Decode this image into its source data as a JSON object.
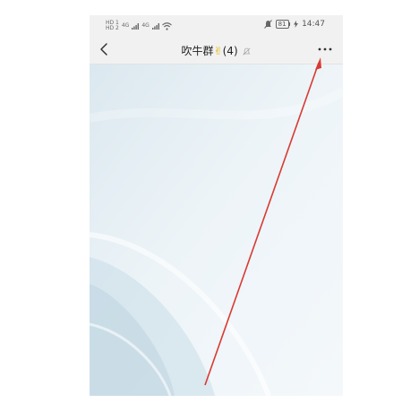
{
  "status_bar": {
    "sim1": "HD 1",
    "sim2": "HD 2",
    "net1": "4G",
    "net2": "4G",
    "battery": "81",
    "time": "14:47"
  },
  "nav": {
    "title": "吹牛群",
    "title_emoji": "✌",
    "member_count": "(4)"
  },
  "icons": {
    "back": "chevron-left-icon",
    "muted": "bell-off-icon",
    "more": "more-dots-icon",
    "wifi": "wifi-icon",
    "signal": "signal-icon",
    "silent": "mute-icon",
    "battery": "battery-icon",
    "charging": "bolt-icon"
  },
  "colors": {
    "bar_bg": "#f1f1f1",
    "chat_bg": "#e9f1f5",
    "arrow": "#d83a32"
  }
}
